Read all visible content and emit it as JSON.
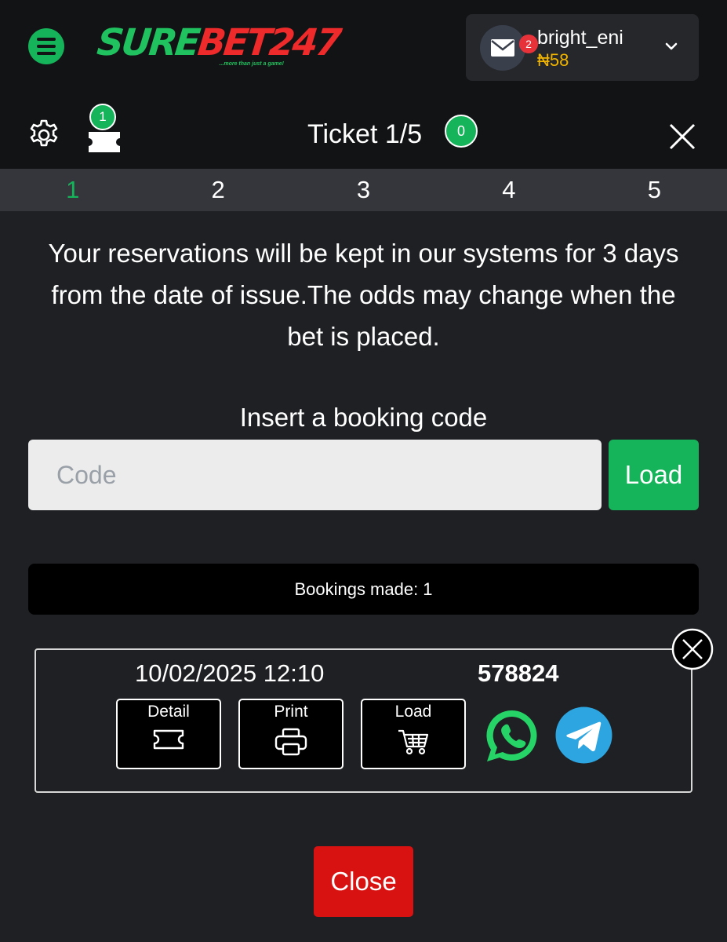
{
  "header": {
    "logo_part1": "SURE",
    "logo_part2": "BET247",
    "logo_tagline": "...more than just a game!",
    "username": "bright_eni",
    "balance": "₦58",
    "mail_badge": "2",
    "icons": [
      "menu-icon",
      "mail-icon",
      "chevron-down-icon"
    ]
  },
  "ticket_bar": {
    "title": "Ticket 1/5",
    "ticket_count": "1",
    "zero_badge": "0",
    "icons": [
      "gear-icon",
      "ticket-icon",
      "close-icon"
    ]
  },
  "tabs": [
    {
      "label": "1",
      "active": true
    },
    {
      "label": "2",
      "active": false
    },
    {
      "label": "3",
      "active": false
    },
    {
      "label": "4",
      "active": false
    },
    {
      "label": "5",
      "active": false
    }
  ],
  "info_text": "Your reservations will be kept in our systems for 3 days from the date of issue.The odds may change when the bet is placed.",
  "booking_form": {
    "label": "Insert a booking code",
    "placeholder": "Code",
    "value": "",
    "load_label": "Load"
  },
  "bookings_made": "Bookings made: 1",
  "booking": {
    "datetime": "10/02/2025 12:10",
    "code": "578824",
    "detail_label": "Detail",
    "print_label": "Print",
    "load_label": "Load",
    "share_icons": [
      "whatsapp-icon",
      "telegram-icon"
    ]
  },
  "close_label": "Close",
  "colors": {
    "accent_green": "#16b45a",
    "balance_yellow": "#f0b400",
    "close_red": "#d81111",
    "background": "#1f2023",
    "logo_red": "#ee2a2a"
  }
}
